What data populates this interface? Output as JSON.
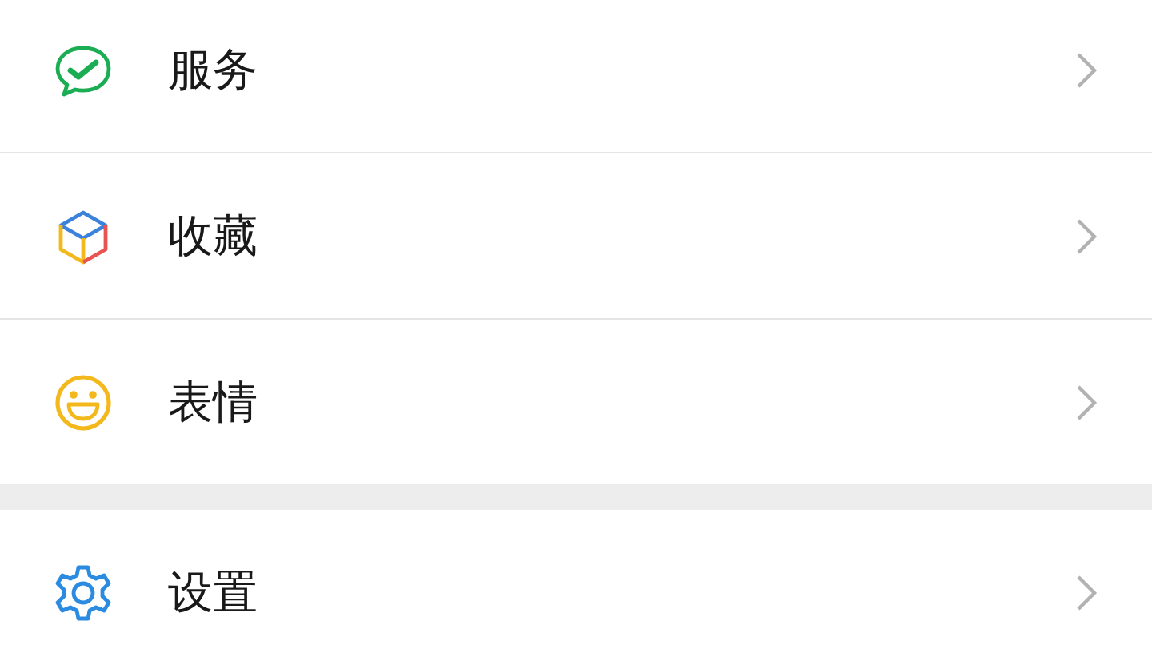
{
  "groups": [
    {
      "items": [
        {
          "label": "服务",
          "kind": "service"
        },
        {
          "label": "收藏",
          "kind": "favorites"
        },
        {
          "label": "表情",
          "kind": "stickers"
        }
      ]
    },
    {
      "items": [
        {
          "label": "设置",
          "kind": "settings"
        }
      ]
    }
  ]
}
